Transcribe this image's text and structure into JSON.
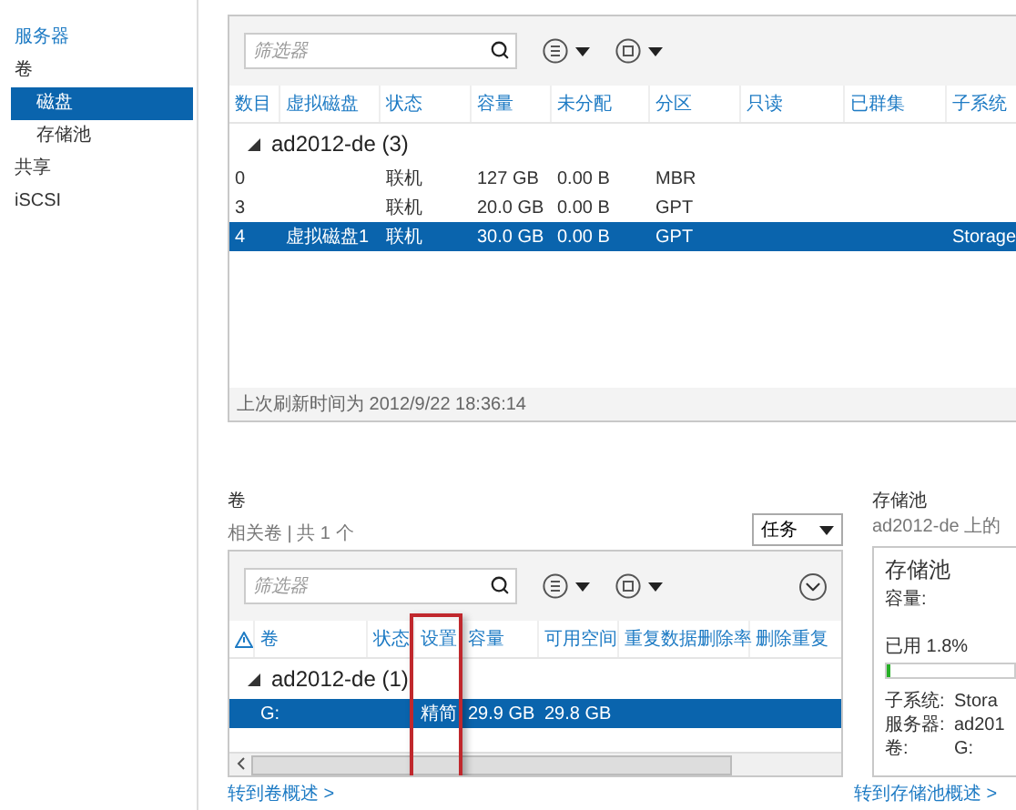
{
  "sidebar": {
    "back_link": "服务器",
    "items": [
      {
        "label": "卷",
        "selected": false,
        "children": [
          {
            "label": "磁盘",
            "selected": true
          },
          {
            "label": "存储池",
            "selected": false
          }
        ]
      },
      {
        "label": "共享",
        "selected": false
      },
      {
        "label": "iSCSI",
        "selected": false
      }
    ]
  },
  "disks": {
    "filter": {
      "placeholder": "筛选器"
    },
    "columns": [
      {
        "label": "数目"
      },
      {
        "label": "虚拟磁盘"
      },
      {
        "label": "状态"
      },
      {
        "label": "容量"
      },
      {
        "label": "未分配"
      },
      {
        "label": "分区"
      },
      {
        "label": "只读"
      },
      {
        "label": "已群集"
      },
      {
        "label": "子系统"
      }
    ],
    "group": {
      "label": "ad2012-de (3)",
      "expanded": true
    },
    "rows": [
      {
        "selected": false,
        "cells": [
          "0",
          "",
          "联机",
          "127 GB",
          "0.00 B",
          "MBR",
          "",
          "",
          ""
        ]
      },
      {
        "selected": false,
        "cells": [
          "3",
          "",
          "联机",
          "20.0 GB",
          "0.00 B",
          "GPT",
          "",
          "",
          ""
        ]
      },
      {
        "selected": true,
        "cells": [
          "4",
          "虚拟磁盘1",
          "联机",
          "30.0 GB",
          "0.00 B",
          "GPT",
          "",
          "",
          "Storage"
        ]
      }
    ],
    "last_refresh": "上次刷新时间为 2012/9/22 18:36:14"
  },
  "volumes": {
    "title": "卷",
    "subtitle": "相关卷 | 共 1 个",
    "tasks_button": "任务",
    "filter": {
      "placeholder": "筛选器"
    },
    "columns": [
      {
        "kind": "icon",
        "highlighted": false
      },
      {
        "kind": "text",
        "label": "卷",
        "highlighted": false
      },
      {
        "kind": "text",
        "label": "状态",
        "highlighted": false
      },
      {
        "kind": "text",
        "label": "设置",
        "highlighted": true
      },
      {
        "kind": "text",
        "label": "容量",
        "highlighted": false
      },
      {
        "kind": "text",
        "label": "可用空间",
        "highlighted": false
      },
      {
        "kind": "text",
        "label": "重复数据删除率",
        "highlighted": false
      },
      {
        "kind": "text",
        "label": "删除重复",
        "highlighted": false
      }
    ],
    "group": {
      "label": "ad2012-de (1)",
      "expanded": true
    },
    "rows": [
      {
        "selected": true,
        "cells": [
          "",
          "G:",
          "",
          "精简",
          "29.9 GB",
          "29.8 GB",
          "",
          ""
        ]
      }
    ],
    "link": "转到卷概述 >"
  },
  "storage_pool": {
    "title": "存储池",
    "subtitle": "ad2012-de 上的",
    "card_title": "存储池",
    "capacity_label": "容量:",
    "used": "已用 1.8%",
    "level": 0.018,
    "details": [
      {
        "label": "子系统:",
        "value": "Stora"
      },
      {
        "label": "服务器:",
        "value": "ad201"
      },
      {
        "label": "卷:",
        "value": "G:"
      }
    ],
    "link": "转到存储池概述 >"
  }
}
